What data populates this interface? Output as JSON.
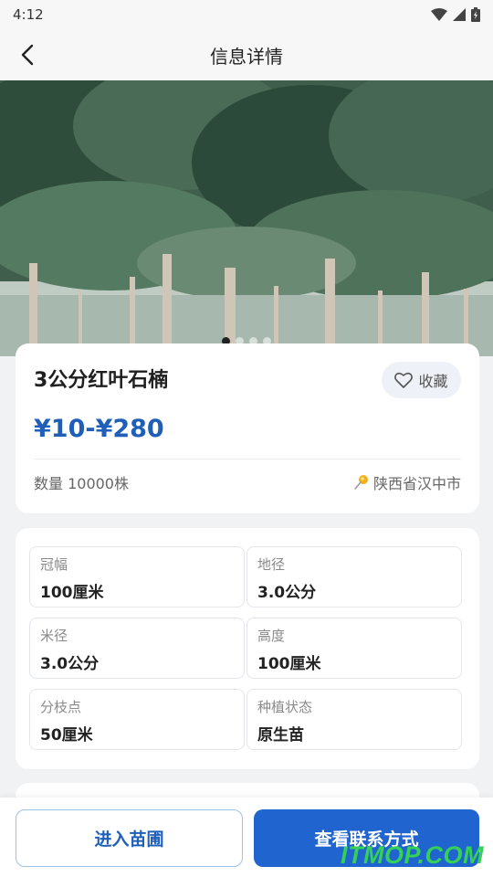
{
  "status_bar": {
    "time": "4:12"
  },
  "nav": {
    "title": "信息详情"
  },
  "hero": {
    "slide_count": 4,
    "active_slide": 0
  },
  "product": {
    "title": "3公分红叶石楠",
    "price": "¥10-¥280",
    "favorite_label": "收藏",
    "quantity": "数量 10000株",
    "location": "陕西省汉中市"
  },
  "specs": [
    {
      "label": "冠幅",
      "value": "100厘米"
    },
    {
      "label": "地径",
      "value": "3.0公分"
    },
    {
      "label": "米径",
      "value": "3.0公分"
    },
    {
      "label": "高度",
      "value": "100厘米"
    },
    {
      "label": "分枝点",
      "value": "50厘米"
    },
    {
      "label": "种植状态",
      "value": "原生苗"
    }
  ],
  "actions": {
    "enter_nursery": "进入苗圃",
    "view_contact": "查看联系方式"
  },
  "watermark": "ITMOP.COM",
  "colors": {
    "accent": "#1f5fb8",
    "primary_button": "#1f64cf",
    "watermark": "#34d058"
  }
}
